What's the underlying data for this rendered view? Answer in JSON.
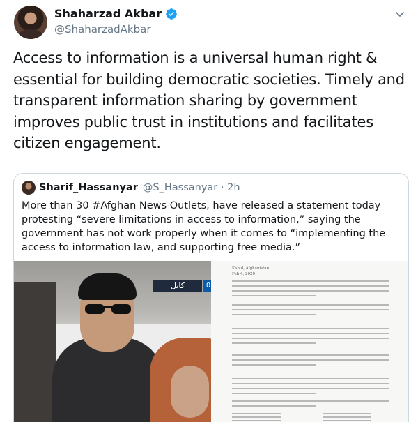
{
  "author": {
    "display_name": "Shaharzad Akbar",
    "handle": "@ShaharzadAkbar"
  },
  "tweet": {
    "text": "Access to information is a universal human right & essential for building democratic societies. Timely and transparent information sharing by government improves public trust in institutions and facilitates citizen engagement."
  },
  "quoted": {
    "display_name": "Sharif_Hassanyar",
    "handle": "@S_Hassanyar · 2h",
    "text": "More than 30 #Afghan News Outlets, have released a statement today protesting “severe limitations in access to information,” saying the government has not work properly when it comes to “implementing the access to information law, and supporting free media.”",
    "photo_tv_label": "کابل",
    "photo_tv_number": "0",
    "doc_header": [
      "Kabul, Afghanistan",
      "Feb 4, 2020"
    ]
  },
  "colors": {
    "verified": "#1da1f2",
    "secondary_text": "#657786",
    "border": "#ccd6dd"
  },
  "icons": {
    "verified": "verified-badge-icon",
    "more": "chevron-down-icon"
  }
}
